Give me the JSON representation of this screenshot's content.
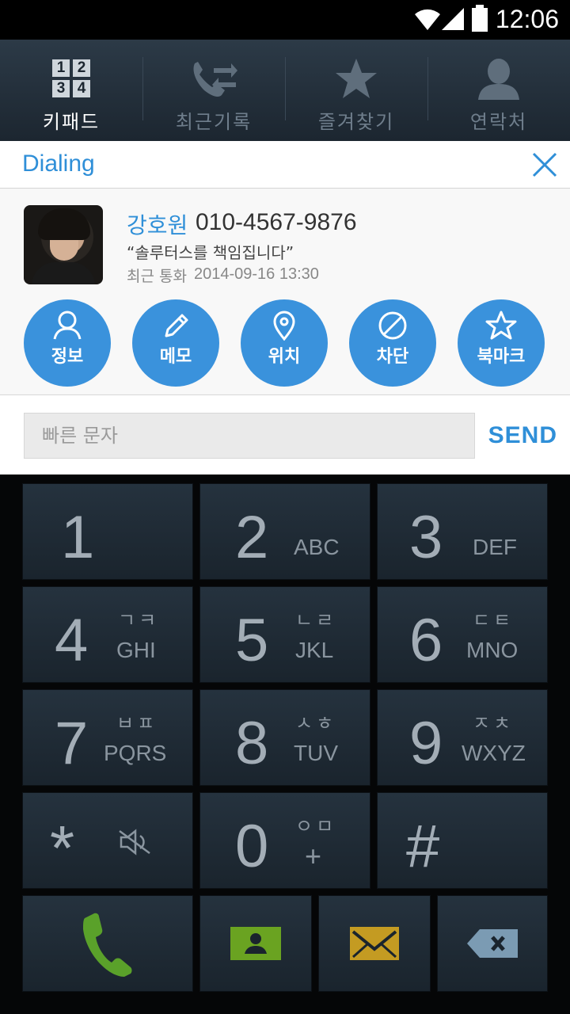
{
  "status_bar": {
    "time": "12:06"
  },
  "tabs": [
    {
      "label": "키패드",
      "icon": "keypad-icon",
      "active": true
    },
    {
      "label": "최근기록",
      "icon": "call-log-icon",
      "active": false
    },
    {
      "label": "즐겨찾기",
      "icon": "star-icon",
      "active": false
    },
    {
      "label": "연락처",
      "icon": "contacts-icon",
      "active": false
    }
  ],
  "keypad_icon_digits": [
    "1",
    "2",
    "3",
    "4"
  ],
  "dialing": {
    "title": "Dialing",
    "contact": {
      "name": "강호원",
      "number": "010-4567-9876",
      "status": "“솔루터스를 책임집니다”",
      "recent_label": "최근 통화",
      "recent_time": "2014-09-16 13:30"
    },
    "actions": [
      {
        "label": "정보",
        "icon": "person-icon"
      },
      {
        "label": "메모",
        "icon": "pencil-icon"
      },
      {
        "label": "위치",
        "icon": "location-pin-icon"
      },
      {
        "label": "차단",
        "icon": "block-icon"
      },
      {
        "label": "북마크",
        "icon": "star-outline-icon"
      }
    ],
    "quick_message": {
      "placeholder": "빠른 문자",
      "send_label": "SEND"
    }
  },
  "keys": [
    {
      "digit": "1",
      "letters": "",
      "korean": ""
    },
    {
      "digit": "2",
      "letters": "ABC",
      "korean": ""
    },
    {
      "digit": "3",
      "letters": "DEF",
      "korean": ""
    },
    {
      "digit": "4",
      "letters": "GHI",
      "korean": "ㄱㅋ"
    },
    {
      "digit": "5",
      "letters": "JKL",
      "korean": "ㄴㄹ"
    },
    {
      "digit": "6",
      "letters": "MNO",
      "korean": "ㄷㅌ"
    },
    {
      "digit": "7",
      "letters": "PQRS",
      "korean": "ㅂㅍ"
    },
    {
      "digit": "8",
      "letters": "TUV",
      "korean": "ㅅㅎ"
    },
    {
      "digit": "9",
      "letters": "WXYZ",
      "korean": "ㅈㅊ"
    },
    {
      "digit": "*",
      "letters": "",
      "korean": ""
    },
    {
      "digit": "0",
      "letters": "+",
      "korean": "ㅇㅁ"
    },
    {
      "digit": "#",
      "letters": "",
      "korean": ""
    }
  ],
  "bottom_actions": [
    {
      "icon": "call-icon",
      "color": "#5aa12a"
    },
    {
      "icon": "add-contact-icon",
      "color": "#6aa321"
    },
    {
      "icon": "message-icon",
      "color": "#c49b22"
    },
    {
      "icon": "backspace-icon",
      "color": "#7b9bb3"
    }
  ],
  "colors": {
    "accent": "#2f8fd8",
    "action_circle": "#3a92dc",
    "key_text": "#a3adb6"
  }
}
